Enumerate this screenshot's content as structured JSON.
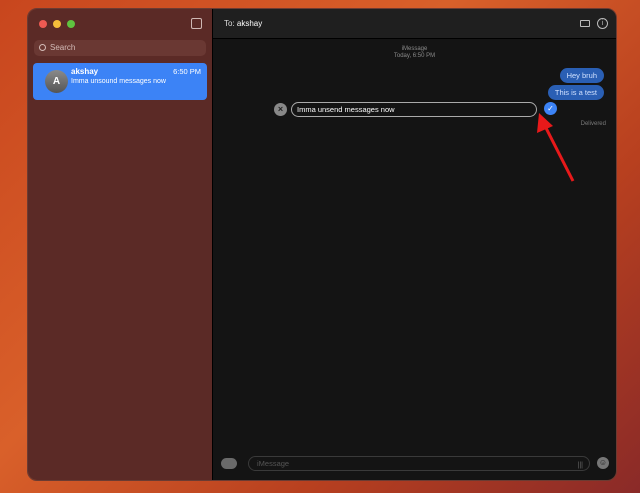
{
  "sidebar": {
    "search_placeholder": "Search",
    "conversation": {
      "initial": "A",
      "name": "akshay",
      "time": "6:50 PM",
      "preview": "Imma unsound messages now"
    }
  },
  "header": {
    "to_label": "To:",
    "recipient": "akshay"
  },
  "thread": {
    "service": "iMessage",
    "timestamp": "Today, 6:50 PM",
    "messages": [
      "Hey bruh",
      "This is a test"
    ],
    "editing_text": "Imma unsend messages now",
    "status": "Delivered"
  },
  "composer": {
    "placeholder": "iMessage"
  },
  "colors": {
    "accent": "#3c83f6",
    "annotation": "#e8191a"
  }
}
